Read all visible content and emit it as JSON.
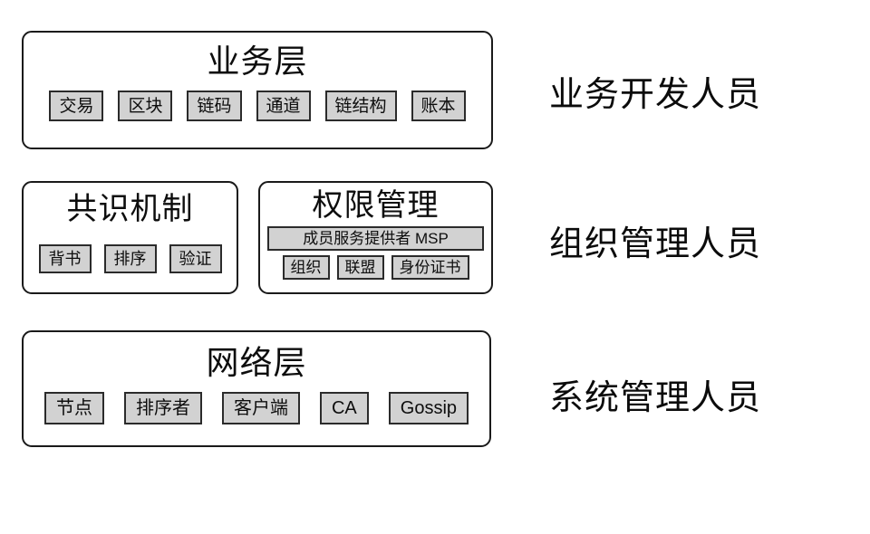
{
  "diagram": {
    "title_text": "",
    "colors": {
      "box_border": "#1a1a1a",
      "chip_fill": "#d2d2d2",
      "chip_border": "#2b2b2b",
      "background": "#ffffff",
      "text": "#0d0d0d"
    },
    "rows": [
      {
        "id": "business",
        "boxes": [
          {
            "title": "业务层",
            "chips": [
              "交易",
              "区块",
              "链码",
              "通道",
              "链结构",
              "账本"
            ]
          }
        ],
        "role": "业务开发人员"
      },
      {
        "id": "management",
        "boxes": [
          {
            "title": "共识机制",
            "chips": [
              "背书",
              "排序",
              "验证"
            ]
          },
          {
            "title": "权限管理",
            "wide_chip": "成员服务提供者 MSP",
            "chips": [
              "组织",
              "联盟",
              "身份证书"
            ]
          }
        ],
        "role": "组织管理人员"
      },
      {
        "id": "network",
        "boxes": [
          {
            "title": "网络层",
            "chips": [
              "节点",
              "排序者",
              "客户端",
              "CA",
              "Gossip"
            ]
          }
        ],
        "role": "系统管理人员"
      }
    ]
  }
}
